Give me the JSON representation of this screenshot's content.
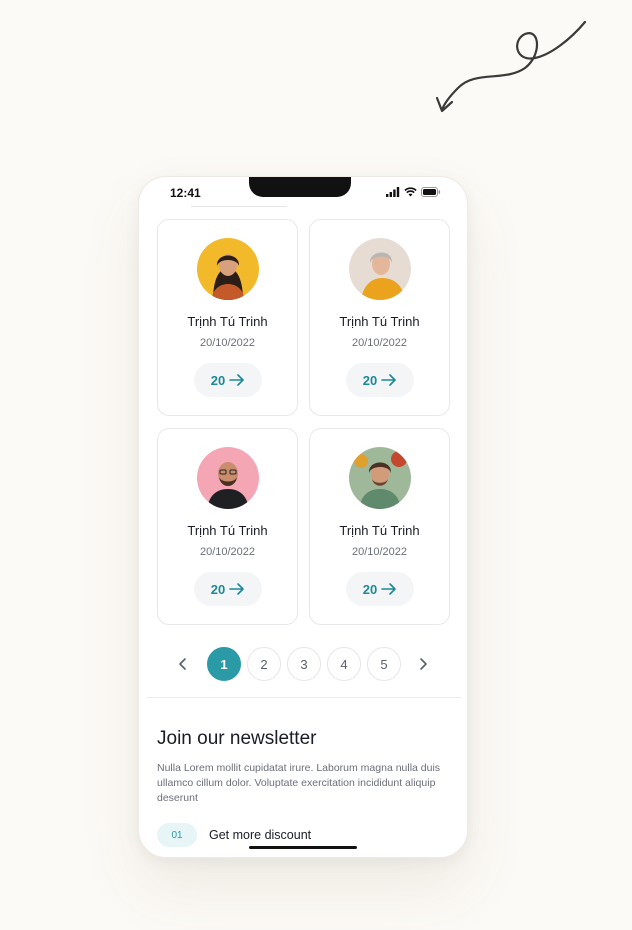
{
  "status": {
    "time": "12:41"
  },
  "cards": [
    {
      "name": "Trịnh Tú Trinh",
      "date": "20/10/2022",
      "count": "20",
      "avatar_bg": "#f2b92b"
    },
    {
      "name": "Trịnh Tú Trinh",
      "date": "20/10/2022",
      "count": "20",
      "avatar_bg": "#e7dcd4"
    },
    {
      "name": "Trịnh Tú Trinh",
      "date": "20/10/2022",
      "count": "20",
      "avatar_bg": "#f4a6b5"
    },
    {
      "name": "Trịnh Tú Trinh",
      "date": "20/10/2022",
      "count": "20",
      "avatar_bg": "#9fb89a"
    }
  ],
  "pagination": {
    "pages": [
      "1",
      "2",
      "3",
      "4",
      "5"
    ],
    "active": "1"
  },
  "newsletter": {
    "title": "Join our newsletter",
    "body": "Nulla Lorem mollit cupidatat irure. Laborum magna nulla duis ullamco cillum dolor. Voluptate exercitation incididunt aliquip deserunt",
    "item_number": "01",
    "item_text": "Get more discount"
  },
  "colors": {
    "accent": "#2a9aa6",
    "background": "#fcfaf6"
  }
}
